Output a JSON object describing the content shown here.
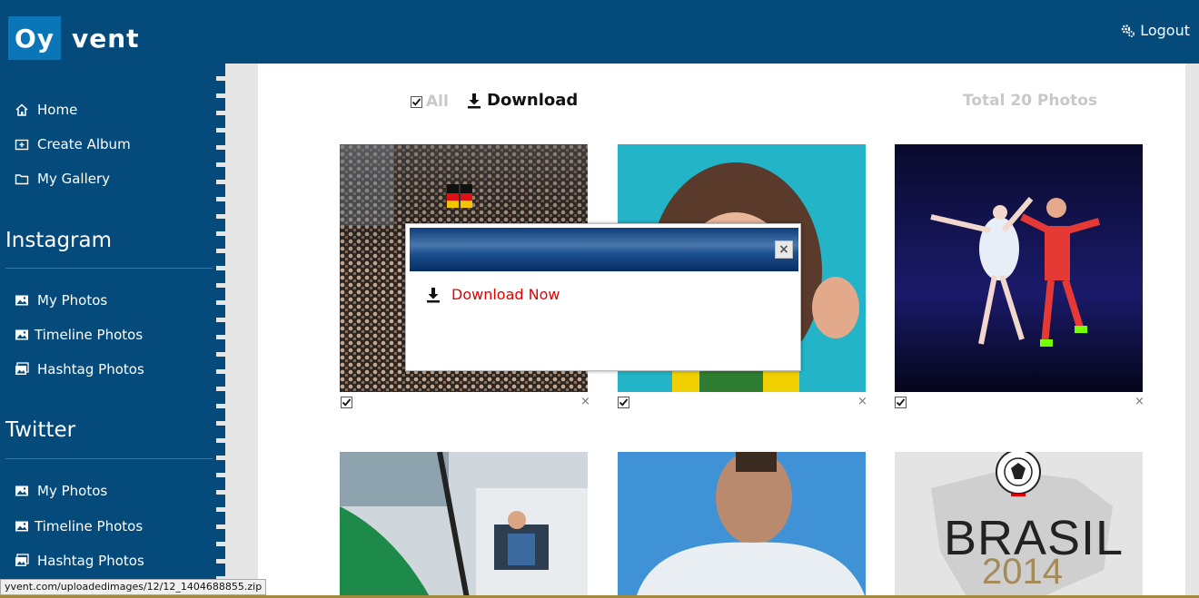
{
  "header": {
    "logo_box_text": "Oy",
    "logo_rest_text": "vent",
    "logout_label": "Logout"
  },
  "sidebar": {
    "main_items": [
      {
        "label": "Home",
        "icon": "home-icon"
      },
      {
        "label": "Create Album",
        "icon": "add-album-icon"
      },
      {
        "label": "My Gallery",
        "icon": "folder-icon"
      }
    ],
    "instagram": {
      "title": "Instagram",
      "items": [
        {
          "label": "My Photos",
          "icon": "image-icon"
        },
        {
          "label": "Timeline Photos",
          "icon": "image-icon"
        },
        {
          "label": "Hashtag Photos",
          "icon": "images-icon"
        }
      ]
    },
    "twitter": {
      "title": "Twitter",
      "items": [
        {
          "label": "My Photos",
          "icon": "image-icon"
        },
        {
          "label": "Timeline Photos",
          "icon": "image-icon"
        },
        {
          "label": "Hashtag Photos",
          "icon": "images-icon"
        }
      ]
    }
  },
  "toolbar": {
    "all_label": "All",
    "all_checked": true,
    "download_label": "Download",
    "total_label": "Total 20 Photos"
  },
  "photos": [
    {
      "subject": "crowd with flag",
      "checked": true,
      "remove_label": "×"
    },
    {
      "subject": "player on cyan background",
      "checked": true,
      "remove_label": "×"
    },
    {
      "subject": "ballet dancer and footballer",
      "checked": true,
      "remove_label": "×"
    },
    {
      "subject": "helicopter",
      "checked": false,
      "remove_label": "×"
    },
    {
      "subject": "player in white shirt",
      "checked": false,
      "remove_label": "×"
    },
    {
      "subject": "Brasil 2014 graphic",
      "checked": false,
      "remove_label": "×",
      "text_line1": "BRASIL",
      "text_line2": "2014"
    }
  ],
  "dialog": {
    "close_label": "×",
    "download_now_label": "Download Now"
  },
  "statusbar": {
    "url": "yvent.com/uploadedimages/12/12_1404688855.zip"
  },
  "colors": {
    "header_bg": "#044b7c",
    "logo_box": "#0a76b8",
    "download_now": "#e20000",
    "muted_text": "#c8c8c8"
  }
}
